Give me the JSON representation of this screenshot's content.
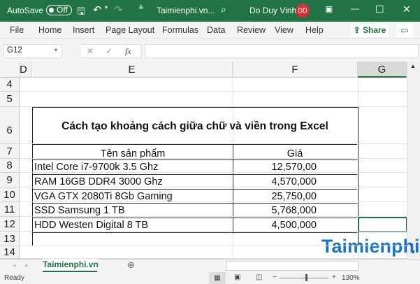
{
  "titlebar": {
    "autosave": "AutoSave",
    "autosave_state": "Off",
    "doc_title": "Taimienphi.vn...",
    "user": "Do Duy Vinh",
    "avatar_initials": "DD"
  },
  "ribbon": {
    "tabs": [
      "File",
      "Home",
      "Insert",
      "Page Layout",
      "Formulas",
      "Data",
      "Review",
      "View",
      "Help"
    ],
    "share": "Share"
  },
  "formula_bar": {
    "name_box": "G12",
    "fx": "fx",
    "value": ""
  },
  "columns": [
    "D",
    "E",
    "F",
    "G"
  ],
  "rows": [
    "4",
    "5",
    "6",
    "7",
    "8",
    "9",
    "10",
    "11",
    "12",
    "13",
    "14"
  ],
  "table": {
    "title": "Cách tạo khoảng cách giữa chữ và viền trong Excel",
    "headers": [
      "Tên sản phẩm",
      "Giá"
    ],
    "items": [
      [
        "Intel Core i7-9700k 3.5 Ghz",
        "12,570,00"
      ],
      [
        "RAM 16GB DDR4 3000 Ghz",
        "4,570,000"
      ],
      [
        "VGA GTX 2080Ti 8Gb Gaming",
        "25,750,00"
      ],
      [
        "SSD Samsung 1 TB",
        "5,768,000"
      ],
      [
        "HDD Westen Digital 8 TB",
        "4,500,000"
      ]
    ]
  },
  "sheet_tab": "Taimienphi.vn",
  "watermark": "Taimienphi.vn",
  "status": {
    "text": "Ready",
    "zoom": "130%",
    "zoom_minus": "−",
    "zoom_plus": "+"
  },
  "colors": {
    "accent": "#217346",
    "avatar": "#d13438"
  }
}
